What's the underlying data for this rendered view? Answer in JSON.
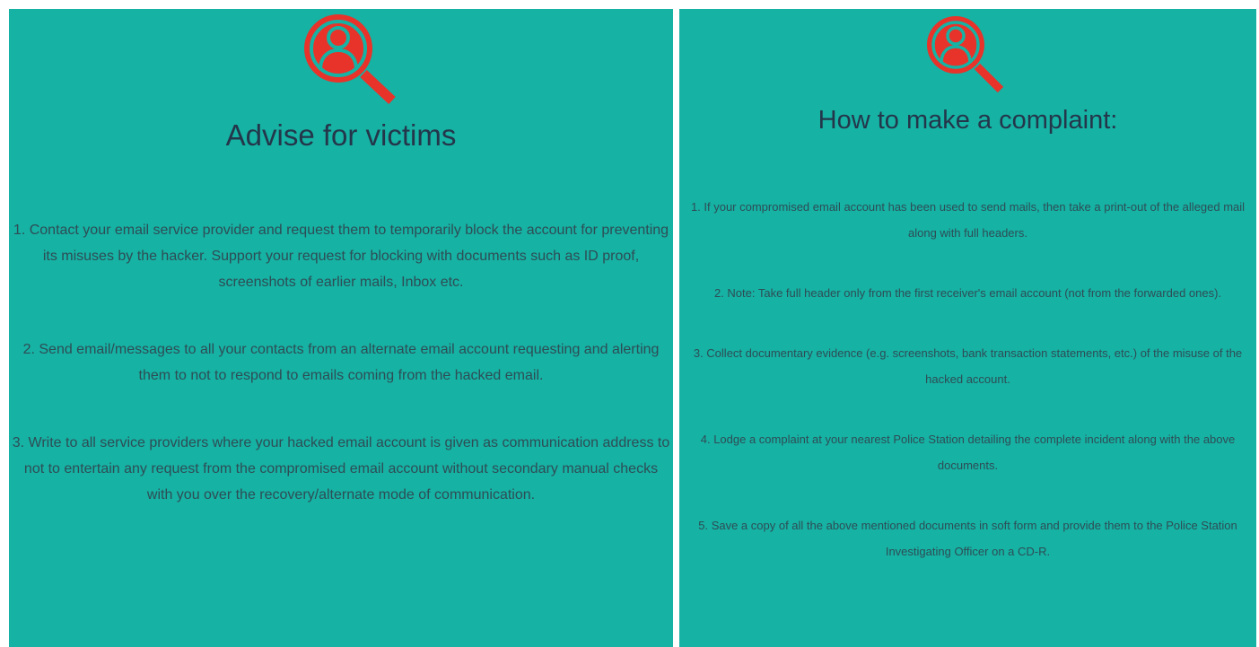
{
  "colors": {
    "panel_background": "#16b2a4",
    "icon_red": "#e8332a",
    "title_text": "#24364a",
    "body_text": "#2e4d55"
  },
  "left_panel": {
    "icon": "magnifier-user-icon",
    "title": "Advise for victims",
    "items": [
      "1. Contact your email service provider and request them to temporarily block the account for preventing its misuses by the hacker. Support your request for blocking with documents such as ID proof, screenshots of earlier mails, Inbox etc.",
      "2. Send email/messages to all your contacts from an alternate email account requesting and alerting them to not to respond to emails coming from the hacked email.",
      "3. Write to all service providers where your hacked email account is given as communication address to not to entertain any request from the compromised email account without secondary manual checks with you over the recovery/alternate mode of communication."
    ]
  },
  "right_panel": {
    "icon": "magnifier-user-icon",
    "title": "How to make a complaint:",
    "items": [
      "1. If your compromised email account has been used to send mails, then take a print-out of the alleged mail along with full headers.",
      "2. Note: Take full header only from the first receiver's email account (not from the forwarded ones).",
      "3. Collect documentary evidence (e.g. screenshots, bank transaction statements, etc.) of the misuse of the hacked account.",
      "4. Lodge a complaint at your nearest Police Station detailing the complete incident along with the above documents.",
      "5. Save a copy of all the above mentioned documents in soft form and provide them to the Police Station Investigating Officer on a CD-R."
    ]
  }
}
